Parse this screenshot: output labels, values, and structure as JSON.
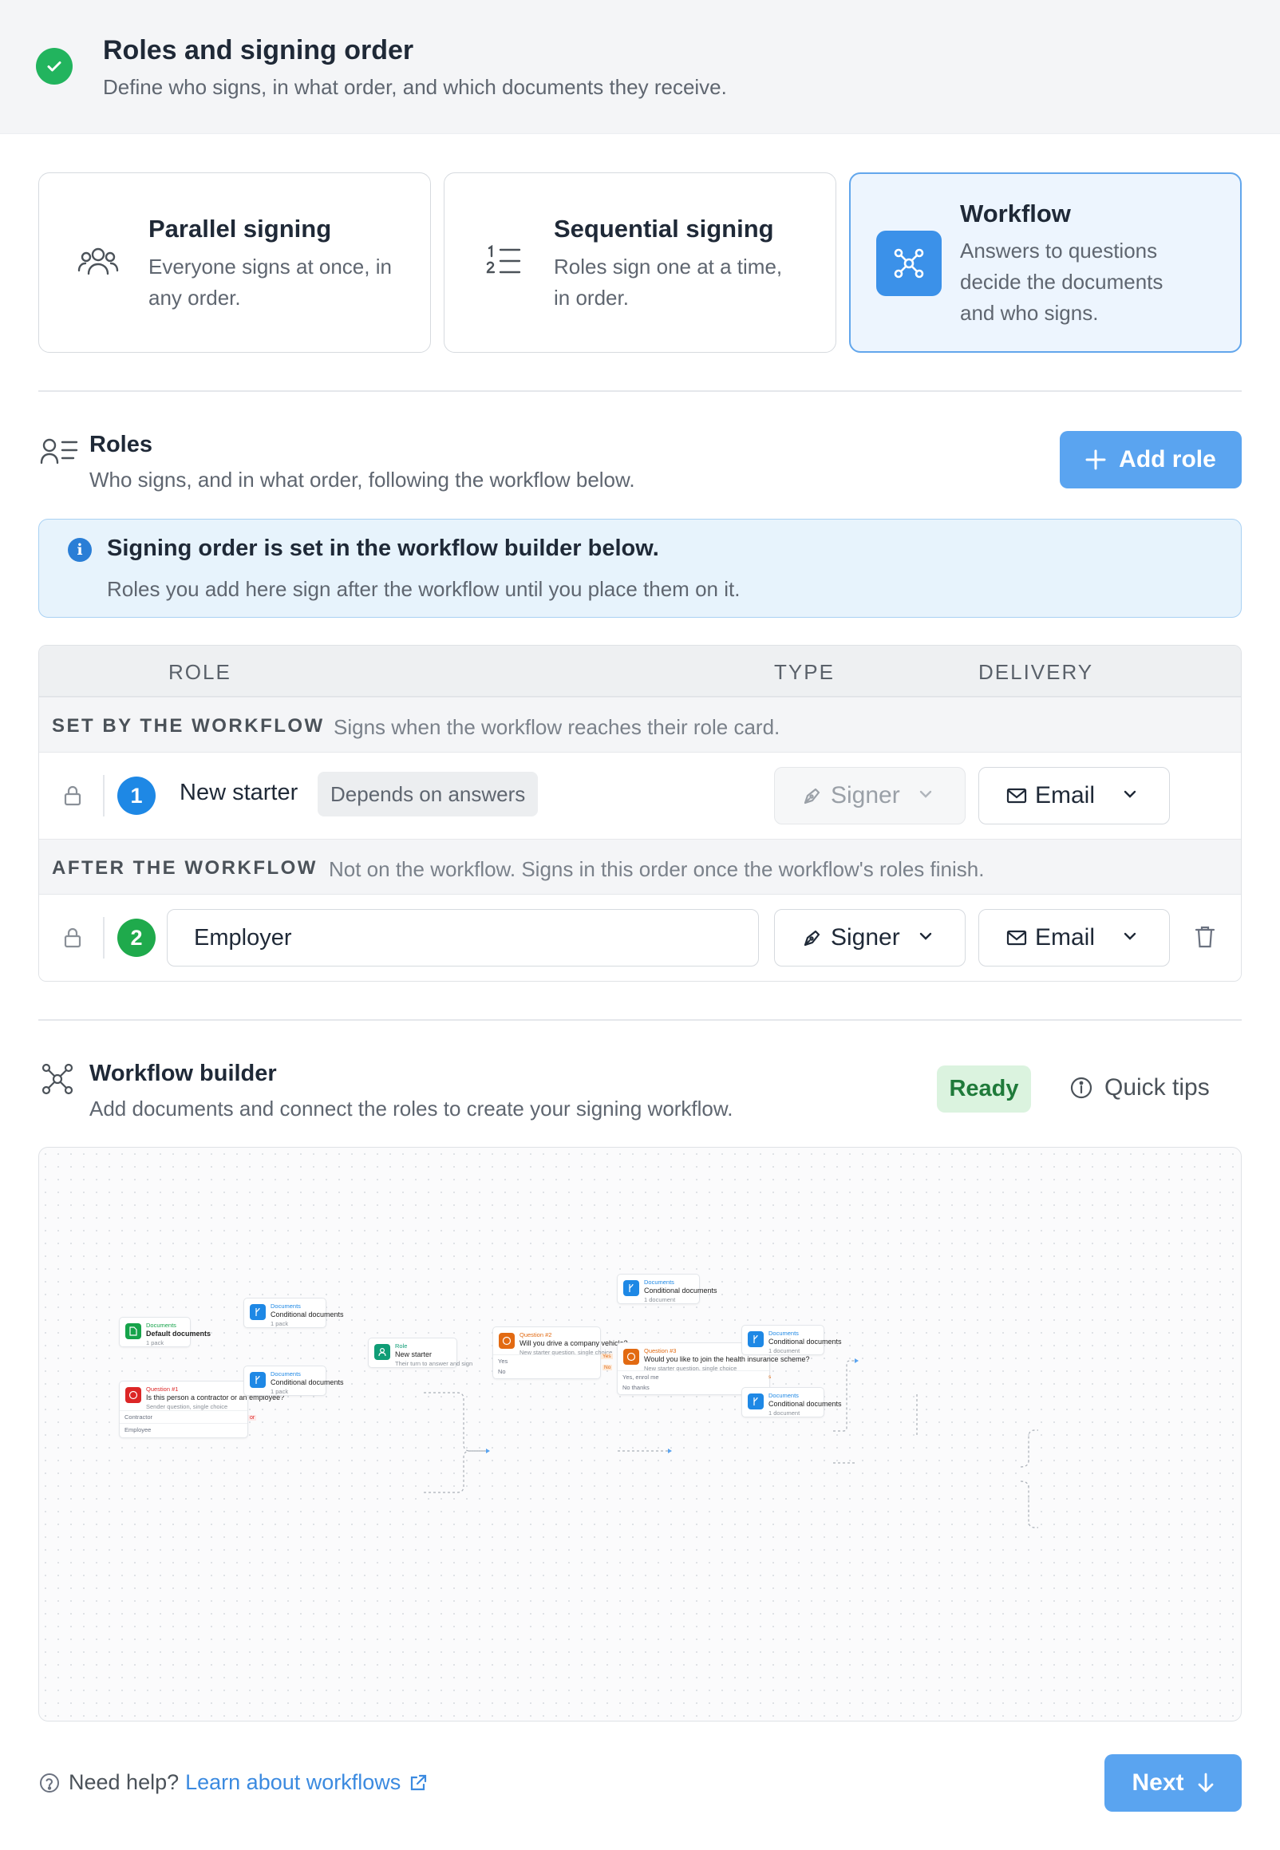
{
  "header": {
    "title": "Roles and signing order",
    "subtitle": "Define who signs, in what order, and which documents they receive."
  },
  "modes": [
    {
      "title": "Parallel signing",
      "desc1": "Everyone signs at once, in",
      "desc2": "any order."
    },
    {
      "title": "Sequential signing",
      "desc1": "Roles sign one at a time,",
      "desc2": "in order."
    },
    {
      "title": "Workflow",
      "desc1": "Answers to questions",
      "desc2": "decide the documents",
      "desc3": "and who signs."
    }
  ],
  "roles": {
    "title": "Roles",
    "subtitle": "Who signs, and in what order, following the workflow below.",
    "add_label": "Add role"
  },
  "notice": {
    "title": "Signing order is set in the workflow builder below.",
    "body": "Roles you add here sign after the workflow until you place them on it."
  },
  "table": {
    "headers": {
      "role": "ROLE",
      "type": "TYPE",
      "delivery": "DELIVERY"
    },
    "group1": {
      "label": "SET BY THE WORKFLOW",
      "desc": "Signs when the workflow reaches their role card."
    },
    "row1": {
      "num": "1",
      "name": "New starter",
      "chip": "Depends on answers",
      "type": "Signer",
      "delivery": "Email"
    },
    "group2": {
      "label": "AFTER THE WORKFLOW",
      "desc": "Not on the workflow. Signs in this order once the workflow's roles finish."
    },
    "row2": {
      "num": "2",
      "name": "Employer",
      "type": "Signer",
      "delivery": "Email"
    }
  },
  "builder": {
    "title": "Workflow builder",
    "subtitle": "Add documents and connect the roles to create your signing workflow.",
    "status": "Ready",
    "tips": "Quick tips"
  },
  "canvas": {
    "default_docs": {
      "type": "Documents",
      "name": "Default documents",
      "sub": "1 pack"
    },
    "q1": {
      "type": "Question #1",
      "name": "Is this person a contractor or an employee?",
      "sub": "Sender question, single choice",
      "opt1": "Contractor",
      "opt2": "Employee"
    },
    "cond1": {
      "type": "Documents",
      "name": "Conditional documents",
      "sub": "1 pack"
    },
    "cond2": {
      "type": "Documents",
      "name": "Conditional documents",
      "sub": "1 pack"
    },
    "role": {
      "type": "Role",
      "name": "New starter",
      "sub": "Their turn to answer and sign"
    },
    "q2": {
      "type": "Question #2",
      "name": "Will you drive a company vehicle?",
      "sub": "New starter question, single choice",
      "opt1": "Yes",
      "opt2": "No"
    },
    "cond3": {
      "type": "Documents",
      "name": "Conditional documents",
      "sub": "1 document"
    },
    "q3": {
      "type": "Question #3",
      "name": "Would you like to join the health insurance scheme?",
      "sub": "New starter question, single choice",
      "opt1": "Yes, enrol me",
      "opt2": "No thanks"
    },
    "cond4": {
      "type": "Documents",
      "name": "Conditional documents",
      "sub": "1 document"
    },
    "cond5": {
      "type": "Documents",
      "name": "Conditional documents",
      "sub": "1 document"
    },
    "edge_or": "or",
    "edge_yes": "Yes",
    "edge_no": "No",
    "edge_s": "s"
  },
  "footer": {
    "help": "Need help?",
    "link": "Learn about workflows",
    "next": "Next"
  },
  "colors": {
    "accent": "#5aa4f0",
    "success": "#22b45e",
    "info_bg": "#e7f3fc"
  }
}
